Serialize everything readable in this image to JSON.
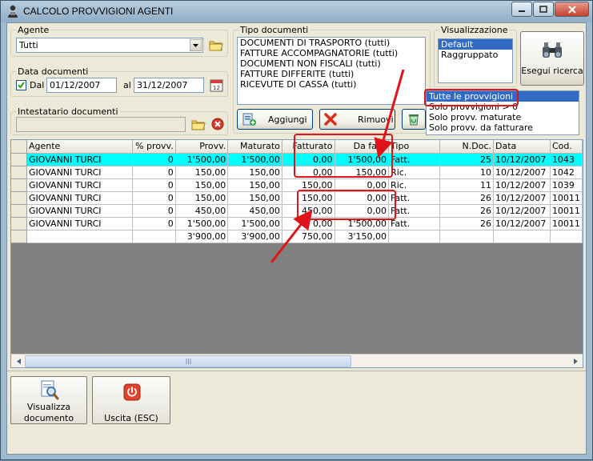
{
  "window": {
    "title": "CALCOLO PROVVIGIONI AGENTI"
  },
  "agente": {
    "label": "Agente",
    "value": "Tutti"
  },
  "data_documenti": {
    "label": "Data documenti",
    "dal_label": "Dal",
    "dal_value": "01/12/2007",
    "al_label": "al",
    "al_value": "31/12/2007",
    "checked": true
  },
  "intestatario": {
    "label": "Intestatario documenti",
    "value": ""
  },
  "tipo_documenti": {
    "label": "Tipo documenti",
    "items": [
      "DOCUMENTI DI TRASPORTO (tutti)",
      "FATTURE ACCOMPAGNATORIE (tutti)",
      "DOCUMENTI NON FISCALI (tutti)",
      "FATTURE DIFFERITE (tutti)",
      "RICEVUTE DI CASSA (tutti)"
    ],
    "aggiungi_label": "Aggiungi",
    "rimuovi_label": "Rimuovi"
  },
  "visualizzazione": {
    "label": "Visualizzazione",
    "items": [
      "Default",
      "Raggruppato"
    ],
    "selected": 0
  },
  "esegui": {
    "label": "Esegui ricerca"
  },
  "filtro_provvigioni": {
    "items": [
      "Tutte le provvigioni",
      "Solo provvigioni > 0",
      "Solo provv. maturate",
      "Solo provv. da fatturare"
    ],
    "selected": 0
  },
  "grid": {
    "columns": [
      "Agente",
      "% provv.",
      "Provv.",
      "Maturato",
      "Fatturato",
      "Da fatt.",
      "Tipo",
      "N.Doc.",
      "Data",
      "Cod."
    ],
    "rows": [
      [
        "GIOVANNI TURCI",
        "0",
        "1'500,00",
        "1'500,00",
        "0,00",
        "1'500,00",
        "Fatt.",
        "25",
        "10/12/2007",
        "1043"
      ],
      [
        "GIOVANNI TURCI",
        "0",
        "150,00",
        "150,00",
        "0,00",
        "150,00",
        "Ric.",
        "10",
        "10/12/2007",
        "1042"
      ],
      [
        "GIOVANNI TURCI",
        "0",
        "150,00",
        "150,00",
        "150,00",
        "0,00",
        "Ric.",
        "11",
        "10/12/2007",
        "1039"
      ],
      [
        "GIOVANNI TURCI",
        "0",
        "150,00",
        "150,00",
        "150,00",
        "0,00",
        "Fatt.",
        "26",
        "10/12/2007",
        "10011"
      ],
      [
        "GIOVANNI TURCI",
        "0",
        "450,00",
        "450,00",
        "450,00",
        "0,00",
        "Fatt.",
        "26",
        "10/12/2007",
        "10011"
      ],
      [
        "GIOVANNI TURCI",
        "0",
        "1'500,00",
        "1'500,00",
        "0,00",
        "1'500,00",
        "Fatt.",
        "26",
        "10/12/2007",
        "10011"
      ]
    ],
    "totals": [
      "",
      "",
      "3'900,00",
      "3'900,00",
      "750,00",
      "3'150,00",
      "",
      "",
      "",
      ""
    ],
    "highlight_row": 0
  },
  "bottom": {
    "visualizza_label_1": "Visualizza",
    "visualizza_label_2": "documento",
    "uscita_label": "Uscita (ESC)"
  },
  "colors": {
    "highlight": "#00ffff",
    "selection": "#316ac5",
    "annotation": "#e0121a"
  }
}
